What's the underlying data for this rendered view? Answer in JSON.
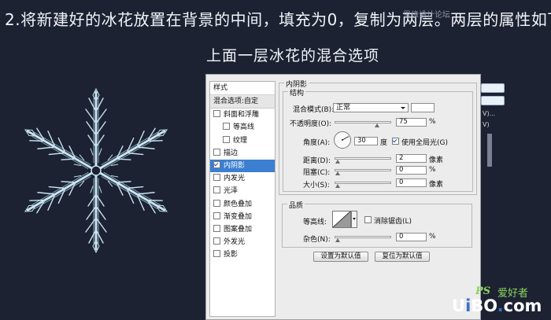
{
  "caption": {
    "line1": "2.将新建好的冰花放置在背景的中间，填充为0，复制为两层。两层的属性如下",
    "line2": "上面一层冰花的混合选项"
  },
  "top_watermark": "思缘设计论坛",
  "colors": {
    "background": "#1c2232",
    "dialog_bg": "#ececec",
    "selected_item": "#3c7fd1",
    "watermark_green": "#8bd45a",
    "watermark_blue": "#3a6fc8"
  },
  "sidebar": {
    "header": "样式",
    "items": [
      {
        "label": "混合选项:自定",
        "checkbox": false,
        "checked": false,
        "indent": false
      },
      {
        "label": "斜面和浮雕",
        "checkbox": true,
        "checked": false,
        "indent": false
      },
      {
        "label": "等高线",
        "checkbox": true,
        "checked": false,
        "indent": true
      },
      {
        "label": "纹理",
        "checkbox": true,
        "checked": false,
        "indent": true
      },
      {
        "label": "描边",
        "checkbox": true,
        "checked": false,
        "indent": false
      },
      {
        "label": "内阴影",
        "checkbox": true,
        "checked": true,
        "indent": false
      },
      {
        "label": "内发光",
        "checkbox": true,
        "checked": false,
        "indent": false
      },
      {
        "label": "光泽",
        "checkbox": true,
        "checked": false,
        "indent": false
      },
      {
        "label": "颜色叠加",
        "checkbox": true,
        "checked": false,
        "indent": false
      },
      {
        "label": "渐变叠加",
        "checkbox": true,
        "checked": false,
        "indent": false
      },
      {
        "label": "图案叠加",
        "checkbox": true,
        "checked": false,
        "indent": false
      },
      {
        "label": "外发光",
        "checkbox": true,
        "checked": false,
        "indent": false
      },
      {
        "label": "投影",
        "checkbox": true,
        "checked": false,
        "indent": false
      }
    ]
  },
  "inner_shadow": {
    "title": "内阴影",
    "structure": {
      "title": "结构",
      "blend_mode_label": "混合模式(B):",
      "blend_mode_value": "正常",
      "opacity_label": "不透明度(O):",
      "opacity_value": "75",
      "opacity_fraction": 0.75,
      "angle_label": "角度(A):",
      "angle_value": "30",
      "angle_unit": "度",
      "global_light_label": "使用全局光(G)",
      "global_light_checked": true,
      "distance_label": "距离(D):",
      "distance_value": "2",
      "choke_label": "阻塞(C):",
      "choke_value": "0",
      "size_label": "大小(S):",
      "size_value": "0",
      "percent_unit": "%",
      "pixel_unit": "像素"
    },
    "quality": {
      "title": "品质",
      "contour_label": "等高线:",
      "antialias_label": "消除锯齿(L)",
      "antialias_checked": false,
      "noise_label": "杂色(N):",
      "noise_value": "0",
      "percent_unit": "%"
    },
    "buttons": {
      "set_default": "设置为默认值",
      "reset_default": "复位为默认值"
    }
  },
  "right_edge_fragments": {
    "line1": "V)...",
    "line2": "V)"
  },
  "watermark": {
    "ps": "PS",
    "cn": "爱好者",
    "main_u": "U",
    "main_i": "i",
    "main_b": "B",
    "main_o": "O",
    "main_dot": ".",
    "main_com": "com"
  }
}
